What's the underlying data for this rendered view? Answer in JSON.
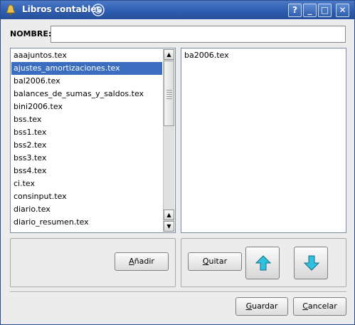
{
  "window": {
    "title": "Libros contables",
    "buttons": {
      "help": "?",
      "minimize": "_",
      "maximize": "□",
      "close": "✕"
    }
  },
  "form": {
    "nombre_label": "NOMBRE:",
    "nombre_value": "",
    "nombre_placeholder": ""
  },
  "left_list": {
    "items": [
      "aaajuntos.tex",
      "ajustes_amortizaciones.tex",
      "bal2006.tex",
      "balances_de_sumas_y_saldos.tex",
      "bini2006.tex",
      "bss.tex",
      "bss1.tex",
      "bss2.tex",
      "bss3.tex",
      "bss4.tex",
      "ci.tex",
      "consinput.tex",
      "diario.tex",
      "diario_resumen.tex"
    ],
    "selected_index": 1
  },
  "right_list": {
    "items": [
      "ba2006.tex"
    ]
  },
  "buttons": {
    "anadir": {
      "prefix": "",
      "mnemonic": "A",
      "rest": "ñadir"
    },
    "quitar": {
      "prefix": "",
      "mnemonic": "Q",
      "rest": "uitar"
    },
    "guardar": {
      "prefix": "",
      "mnemonic": "G",
      "rest": "uardar"
    },
    "cancelar": {
      "prefix": "",
      "mnemonic": "C",
      "rest": "ancelar"
    }
  },
  "icons": {
    "move_up": "arrow-up-icon",
    "move_down": "arrow-down-icon",
    "arrow_color": "#2fc1e0"
  },
  "colors": {
    "titlebar": "#2d5caf",
    "selection": "#3a6dc0"
  }
}
